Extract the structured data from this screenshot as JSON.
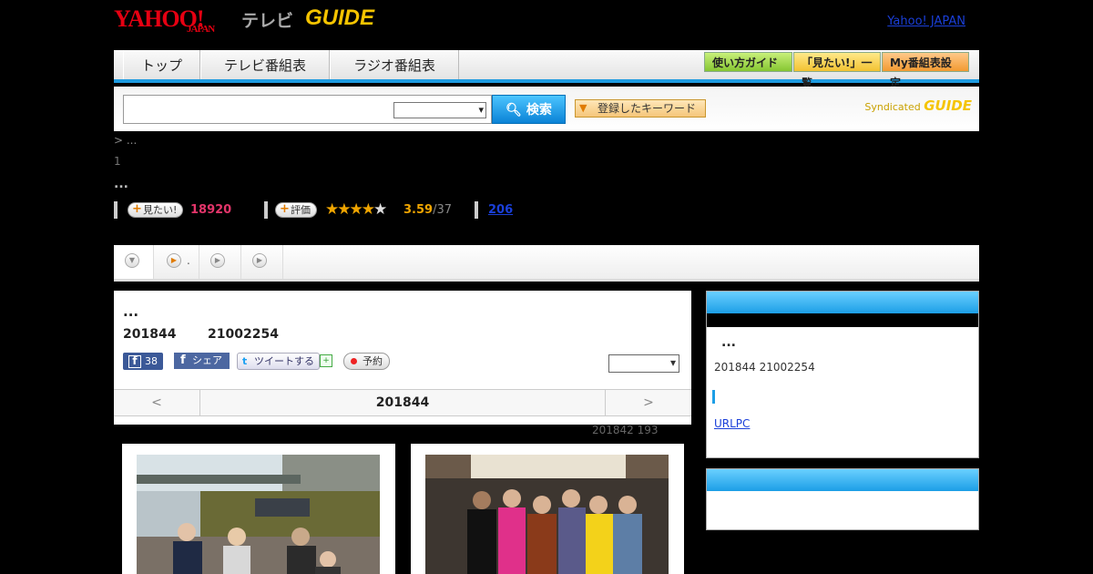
{
  "header": {
    "logo_yahoo": "YAHOO!",
    "logo_japan": "JAPAN",
    "logo_tv": "テレビ",
    "logo_gguide": "GUIDE",
    "link_yahoo_japan": "Yahoo! JAPAN"
  },
  "nav": {
    "tabs": [
      "トップ",
      "テレビ番組表",
      "ラジオ番組表"
    ],
    "buttons": [
      "使い方ガイド",
      "「見たい!」一覧",
      "My番組表設定"
    ]
  },
  "search": {
    "placeholder": "",
    "button_label": "検索",
    "keyword_button": "登録したキーワード",
    "syndicated": "Syndicated",
    "syndicated_logo": "GUIDE"
  },
  "breadcrumb": "> ...",
  "count_line": "1",
  "title_dots": "...",
  "stats": {
    "mitai_label": "見たい!",
    "mitai_count": "18920",
    "hyoka_label": "評価",
    "rating": "3.59",
    "rating_count": "/37",
    "stars_on": "★★★★",
    "stars_off": "★",
    "link_count": "206"
  },
  "tabs": [
    {
      "icon": "chevron-down-icon",
      "label": ""
    },
    {
      "icon": "play-icon",
      "label": "."
    },
    {
      "icon": "play-icon",
      "label": ""
    },
    {
      "icon": "play-icon",
      "label": ""
    }
  ],
  "main": {
    "dots": "...",
    "date": "201844",
    "code": "21002254",
    "fb_count": "38",
    "fb_share": "シェア",
    "tweet": "ツイートする",
    "reserve": "予約",
    "pager_prev": "<",
    "pager_current": "201844",
    "pager_next": ">",
    "sub_meta": "201842  193"
  },
  "sidebar": {
    "dots": "...",
    "meta": "201844  21002254",
    "link": "URLPC"
  },
  "colors": {
    "accent_blue": "#1e9be0",
    "pink": "#e3356a",
    "star": "#f0a500",
    "link": "#1a3fd9"
  }
}
